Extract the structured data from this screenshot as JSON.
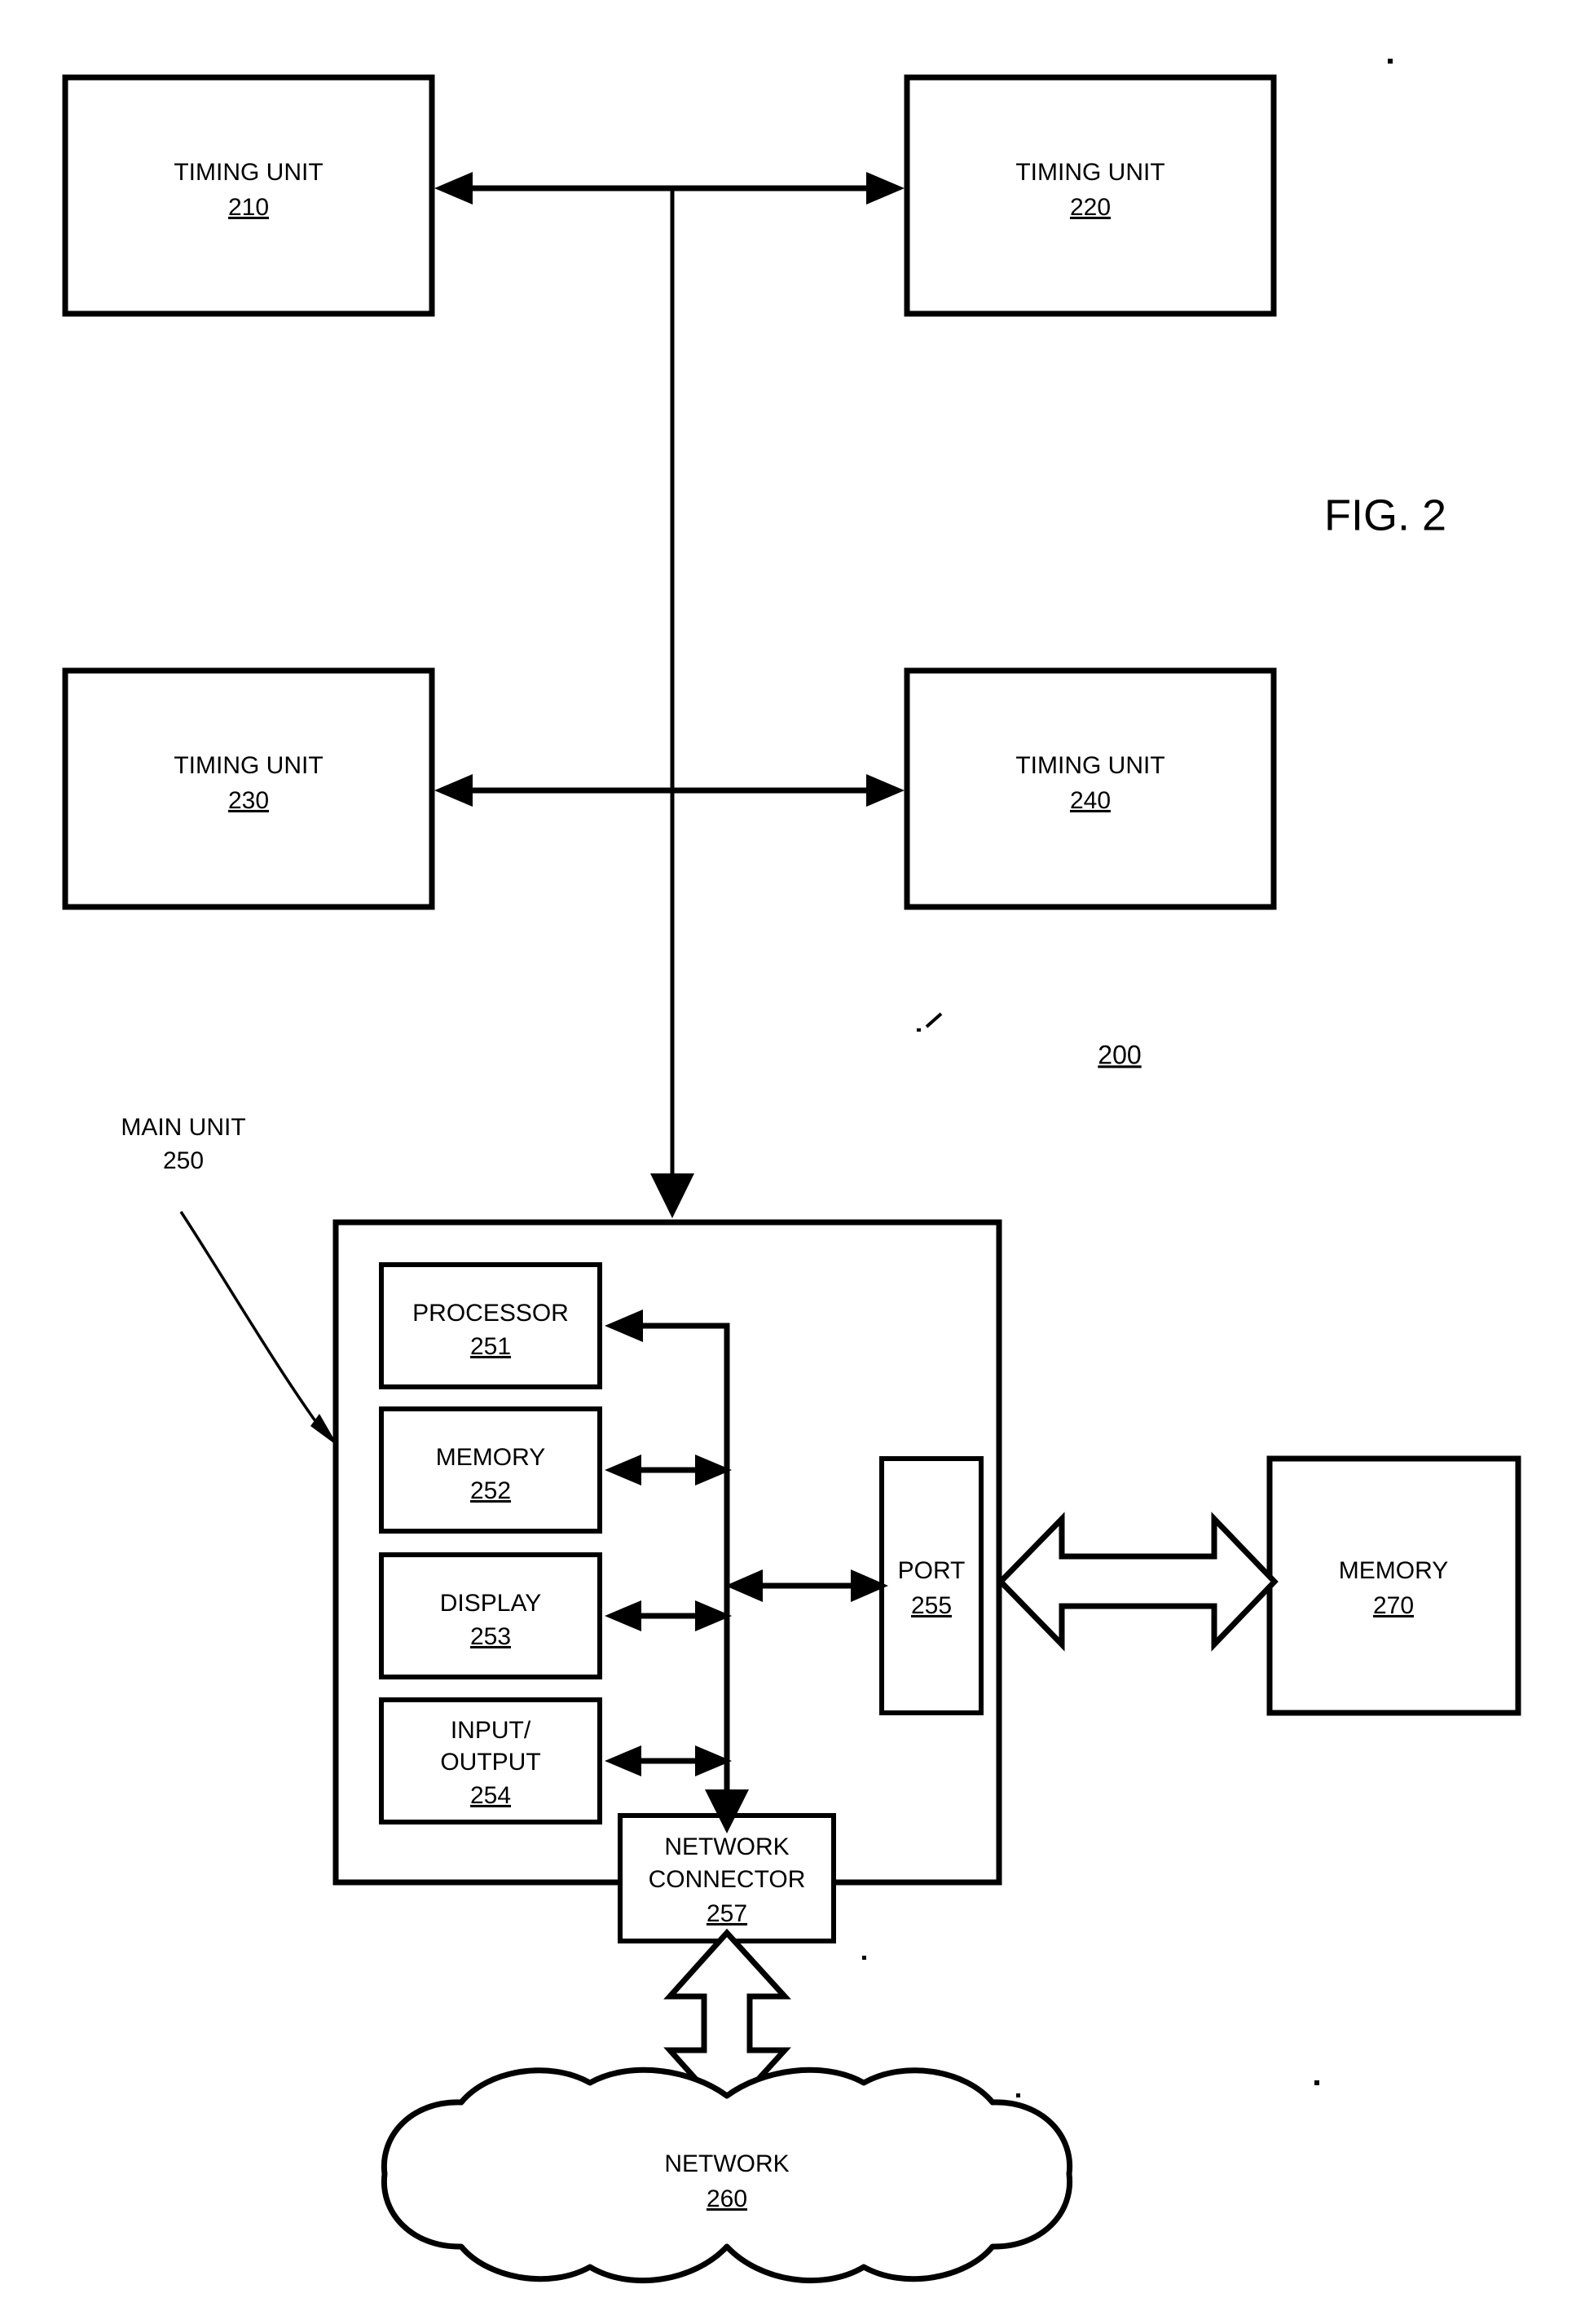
{
  "figure": {
    "title": "FIG. 2",
    "system_reference": "200"
  },
  "timing_units": [
    {
      "name": "timing-unit-210",
      "label": "TIMING UNIT",
      "ref": "210"
    },
    {
      "name": "timing-unit-220",
      "label": "TIMING UNIT",
      "ref": "220"
    },
    {
      "name": "timing-unit-230",
      "label": "TIMING UNIT",
      "ref": "230"
    },
    {
      "name": "timing-unit-240",
      "label": "TIMING UNIT",
      "ref": "240"
    }
  ],
  "main_unit": {
    "callout_label": "MAIN UNIT",
    "callout_ref": "250",
    "components": [
      {
        "name": "processor",
        "label": "PROCESSOR",
        "ref": "251"
      },
      {
        "name": "memory",
        "label": "MEMORY",
        "ref": "252"
      },
      {
        "name": "display",
        "label": "DISPLAY",
        "ref": "253"
      },
      {
        "name": "input-output",
        "label_line1": "INPUT/",
        "label_line2": "OUTPUT",
        "ref": "254"
      },
      {
        "name": "port",
        "label": "PORT",
        "ref": "255"
      },
      {
        "name": "network-connector",
        "label_line1": "NETWORK",
        "label_line2": "CONNECTOR",
        "ref": "257"
      }
    ]
  },
  "external": {
    "memory": {
      "label": "MEMORY",
      "ref": "270"
    },
    "network": {
      "label": "NETWORK",
      "ref": "260"
    }
  },
  "colors": {
    "ink": "#000000",
    "paper": "#ffffff"
  }
}
